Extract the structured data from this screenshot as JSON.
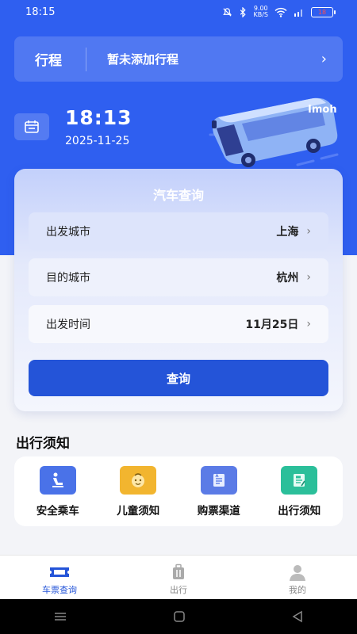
{
  "status_bar": {
    "time": "18:15",
    "net_speed_value": "9.00",
    "net_speed_unit": "KB/S",
    "battery": "18"
  },
  "trip": {
    "title": "行程",
    "message": "暂未添加行程"
  },
  "clock": {
    "time": "18:13",
    "date": "2025-11-25"
  },
  "bus_label": "Imoh",
  "query": {
    "title": "汽车查询",
    "rows": [
      {
        "label": "出发城市",
        "value": "上海"
      },
      {
        "label": "目的城市",
        "value": "杭州"
      },
      {
        "label": "出发时间",
        "value": "11月25日"
      }
    ],
    "button": "查询"
  },
  "notices": {
    "title": "出行须知",
    "items": [
      {
        "label": "安全乘车",
        "icon": "seat-icon",
        "color": "#4a72e8"
      },
      {
        "label": "儿童须知",
        "icon": "child-face-icon",
        "color": "#f2b52f"
      },
      {
        "label": "购票渠道",
        "icon": "ticket-doc-icon",
        "color": "#5b7be6"
      },
      {
        "label": "出行须知",
        "icon": "notice-note-icon",
        "color": "#2bbf9a"
      }
    ]
  },
  "tabs": [
    {
      "label": "车票查询",
      "icon": "ticket-icon",
      "active": true
    },
    {
      "label": "出行",
      "icon": "luggage-icon",
      "active": false
    },
    {
      "label": "我的",
      "icon": "user-icon",
      "active": false
    }
  ],
  "colors": {
    "primary": "#2f5ff0",
    "button": "#2454d8",
    "tab_active": "#2454d8"
  }
}
